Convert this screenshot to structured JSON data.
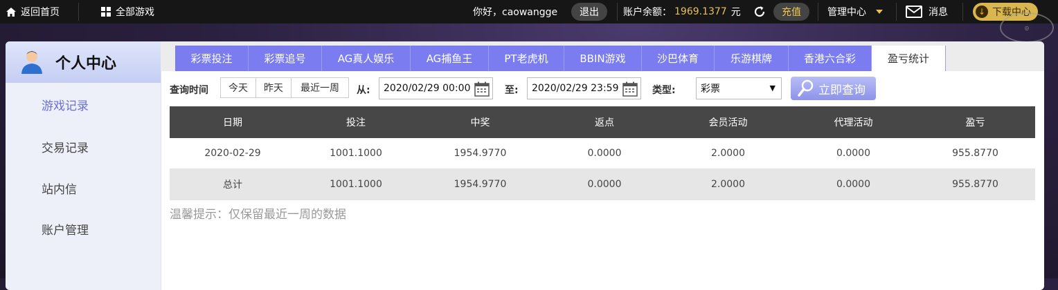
{
  "topbar": {
    "home_label": "返回首页",
    "all_games_label": "全部游戏",
    "greeting": "你好，caowangge",
    "logout_label": "退出",
    "balance_label": "账户余额：",
    "balance_value": "1969.1377",
    "balance_unit": "元",
    "recharge_label": "充值",
    "manage_label": "管理中心",
    "messages_label": "消息",
    "download_label": "下载中心",
    "accent_color": "#e8c15a"
  },
  "sidebar": {
    "title": "个人中心",
    "items": [
      {
        "label": "游戏记录",
        "active": true
      },
      {
        "label": "交易记录"
      },
      {
        "label": "站内信"
      },
      {
        "label": "账户管理"
      }
    ]
  },
  "tabs": [
    {
      "label": "彩票投注"
    },
    {
      "label": "彩票追号"
    },
    {
      "label": "AG真人娱乐"
    },
    {
      "label": "AG捕鱼王"
    },
    {
      "label": "PT老虎机"
    },
    {
      "label": "BBIN游戏"
    },
    {
      "label": "沙巴体育"
    },
    {
      "label": "乐游棋牌"
    },
    {
      "label": "香港六合彩"
    },
    {
      "label": "盈亏统计",
      "active": true
    }
  ],
  "filters": {
    "time_label": "查询时间",
    "today": "今天",
    "yesterday": "昨天",
    "last_week": "最近一周",
    "from_label": "从:",
    "from_value": "2020/02/29 00:00",
    "to_label": "至:",
    "to_value": "2020/02/29 23:59",
    "type_label": "类型:",
    "type_value": "彩票",
    "search_label": "立即查询"
  },
  "table": {
    "headers": [
      "日期",
      "投注",
      "中奖",
      "返点",
      "会员活动",
      "代理活动",
      "盈亏"
    ],
    "rows": [
      [
        "2020-02-29",
        "1001.1000",
        "1954.9770",
        "0.0000",
        "2.0000",
        "0.0000",
        "955.8770"
      ]
    ],
    "total": [
      "总计",
      "1001.1000",
      "1954.9770",
      "0.0000",
      "2.0000",
      "0.0000",
      "955.8770"
    ]
  },
  "tip": "温馨提示：仅保留最近一周的数据"
}
